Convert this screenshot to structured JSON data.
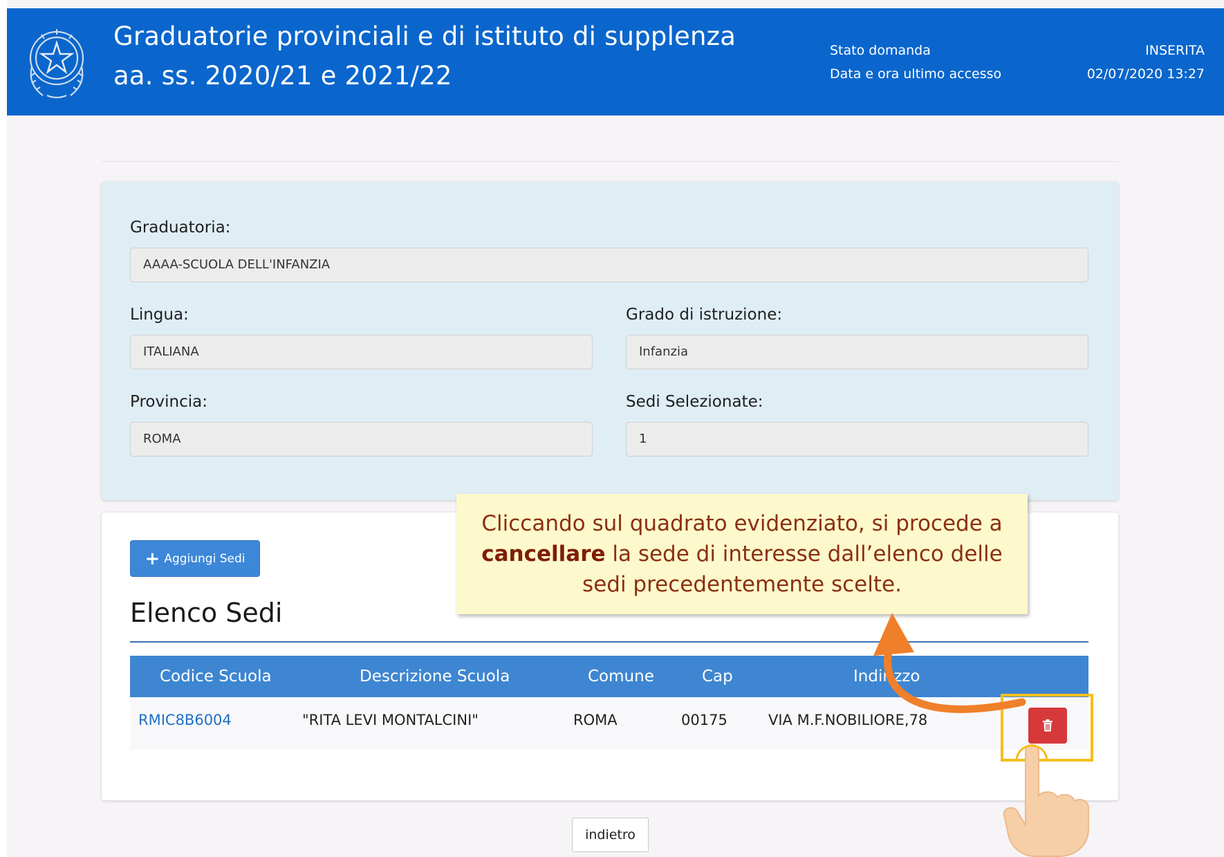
{
  "header": {
    "title_line1": "Graduatorie provinciali e di istituto di supplenza",
    "title_line2": "aa. ss. 2020/21 e 2021/22",
    "status_label": "Stato domanda",
    "status_value": "INSERITA",
    "last_access_label": "Data e ora ultimo accesso",
    "last_access_value": "02/07/2020 13:27"
  },
  "form": {
    "graduatoria": {
      "label": "Graduatoria:",
      "value": "AAAA-SCUOLA DELL'INFANZIA"
    },
    "lingua": {
      "label": "Lingua:",
      "value": "ITALIANA"
    },
    "grado": {
      "label": "Grado di istruzione:",
      "value": "Infanzia"
    },
    "provincia": {
      "label": "Provincia:",
      "value": "ROMA"
    },
    "sedi_selezionate": {
      "label": "Sedi Selezionate:",
      "value": "1"
    }
  },
  "sedi": {
    "add_button_label": "Aggiungi Sedi",
    "section_title": "Elenco Sedi",
    "columns": [
      "Codice Scuola",
      "Descrizione Scuola",
      "Comune",
      "Cap",
      "Indirizzo"
    ],
    "rows": [
      {
        "codice": "RMIC8B6004",
        "descrizione": "\"RITA LEVI MONTALCINI\"",
        "comune": "ROMA",
        "cap": "00175",
        "indirizzo": "VIA M.F.NOBILIORE,78"
      }
    ]
  },
  "callout": {
    "before": "Cliccando sul quadrato evidenziato, si procede a ",
    "bold": "cancellare",
    "after": " la sede di interesse dall’elenco delle sedi precedentemente scelte."
  },
  "footer": {
    "back_label": "indietro"
  },
  "colors": {
    "header_blue": "#0a66cc",
    "table_header_blue": "#3e86d1",
    "delete_red": "#d6393a",
    "highlight_yellow": "#f4bf1d",
    "arrow_orange": "#f07f2a",
    "callout_bg": "#fdf9cc"
  },
  "icons": [
    "republic-emblem-icon",
    "plus-icon",
    "trash-icon",
    "curved-arrow-icon",
    "pointing-hand-icon"
  ]
}
